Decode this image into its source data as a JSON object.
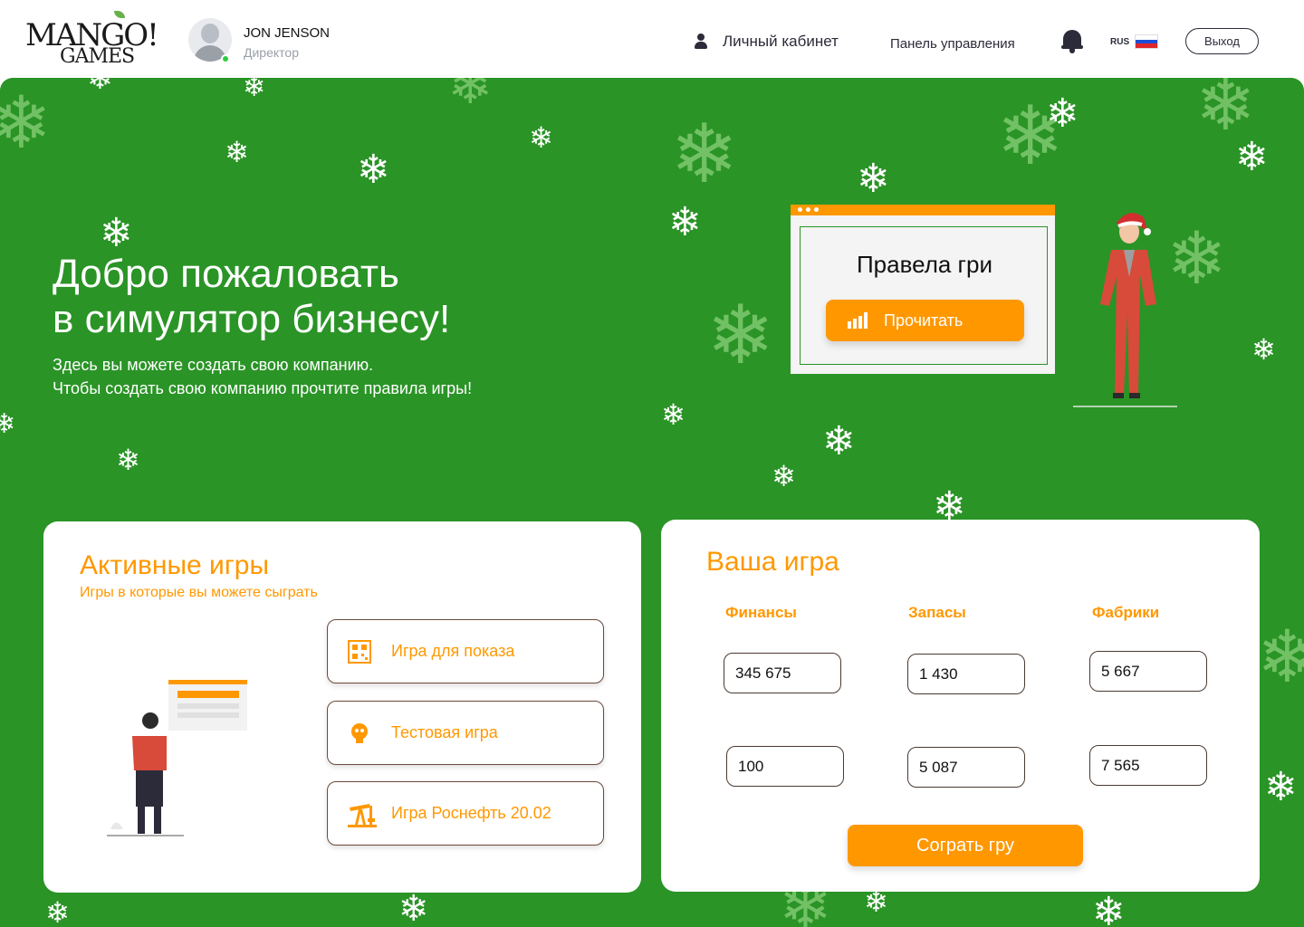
{
  "header": {
    "logo_line1": "MANGO!",
    "logo_line2": "GAMES",
    "user_name": "JON JENSON",
    "user_role": "Директор",
    "nav_cabinet": "Личный кабинет",
    "nav_panel": "Панель управления",
    "lang": "RUS",
    "logout": "Выход"
  },
  "hero": {
    "title_line1": "Добро пожаловать",
    "title_line2": "в симулятор бизнесу!",
    "sub_line1": "Здесь вы можете создать свою  компанию.",
    "sub_line2": "Чтобы создать свою компанию прочтите правила игры!",
    "rules_title": "Правела гри",
    "read_button": "Прочитать"
  },
  "active_games": {
    "title": "Активные игры",
    "subtitle": "Игры в которые вы можете сыграть",
    "items": [
      {
        "label": "Игра для показа",
        "icon": "qr-code-icon"
      },
      {
        "label": "Тестовая игра",
        "icon": "robot-head-icon"
      },
      {
        "label": "Игра Роснефть 20.02",
        "icon": "oil-pump-icon"
      }
    ]
  },
  "your_game": {
    "title": "Ваша игра",
    "columns": [
      "Финансы",
      "Запасы",
      "Фабрики"
    ],
    "row1": [
      "345 675",
      "1 430",
      "5 667"
    ],
    "row2": [
      "100",
      "5 087",
      "7 565"
    ],
    "start_button": "Сограть гру"
  },
  "colors": {
    "accent": "#ff9800",
    "hero_green": "#2a9426",
    "text_dark": "#2b2b3a"
  }
}
